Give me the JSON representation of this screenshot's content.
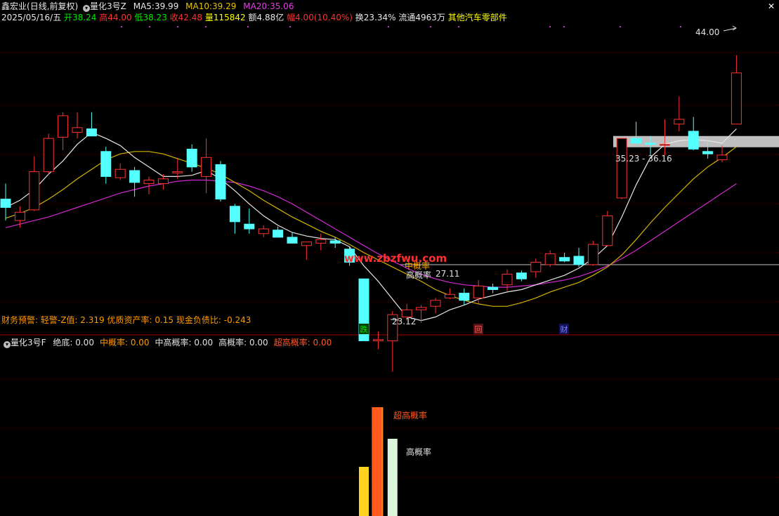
{
  "header": {
    "stock_name": "鑫宏业",
    "period": "(日线,前复权)",
    "indicator": "量化3号Z",
    "ma5_label": "MA5:",
    "ma5_value": "39.99",
    "ma10_label": "MA10:",
    "ma10_value": "39.29",
    "ma20_label": "MA20:",
    "ma20_value": "35.06"
  },
  "quote": {
    "date": "2025/05/16/五",
    "open_label": "开",
    "open": "38.24",
    "high_label": "高",
    "high": "44.00",
    "low_label": "低",
    "low": "38.23",
    "close_label": "收",
    "close": "42.48",
    "vol_label": "量",
    "volume": "115842",
    "amount_label": "额",
    "amount": "4.88亿",
    "change_label": "幅",
    "change": "4.00(10.40%)",
    "turnover_label": "换",
    "turnover": "23.34%",
    "float_label": "流通",
    "float": "4963万",
    "sector": "其他汽车零部件"
  },
  "finance_bar": {
    "prefix": "财务预警: 轻警-Z值: ",
    "z_value": "2.319",
    "quality_label": " 优质资产率: ",
    "quality_value": "0.15",
    "cash_label": " 现金负债比: ",
    "cash_value": "-0.243"
  },
  "sub_header": {
    "indicator": "量化3号F",
    "items": [
      {
        "label": "绝底:",
        "value": "0.00",
        "color": "#e0e0e0"
      },
      {
        "label": "中概率:",
        "value": "0.00",
        "color": "#ff9900"
      },
      {
        "label": "中高概率:",
        "value": "0.00",
        "color": "#e0e0e0"
      },
      {
        "label": "高概率:",
        "value": "0.00",
        "color": "#e0e0e0"
      },
      {
        "label": "超高概率:",
        "value": "0.00",
        "color": "#ff5a2a"
      }
    ]
  },
  "annotations": {
    "high_price": "44.00",
    "range": "35.23 - 36.16",
    "mid_prob": "中概率",
    "high_prob": "高概率",
    "level_27": "27.11",
    "low_price": "23.12",
    "low_prefix": "",
    "marker_die": "跌",
    "marker_hui": "回",
    "marker_cai": "财",
    "super_high_label": "超高概率",
    "high_label_sub": "高概率",
    "watermark": "www.zbzfwu.com"
  },
  "colors": {
    "up": "#ff3232",
    "down": "#54ffff",
    "ma5": "#e6e6e6",
    "ma10": "#d4b300",
    "ma20": "#d228d2",
    "label_up": "#ff3232",
    "label_down": "#00e600",
    "label_yellow": "#ffff00",
    "label_orange": "#ff9900"
  },
  "chart_data": {
    "type": "candlestick",
    "y_unit": "price",
    "ylim": [
      21.5,
      46.5
    ],
    "candles": [
      {
        "o": 31.9,
        "h": 33.2,
        "l": 30.1,
        "c": 31.2
      },
      {
        "o": 30.1,
        "h": 31.3,
        "l": 29.5,
        "c": 30.8
      },
      {
        "o": 31.0,
        "h": 35.5,
        "l": 30.9,
        "c": 34.2
      },
      {
        "o": 34.2,
        "h": 37.4,
        "l": 33.9,
        "c": 37.0
      },
      {
        "o": 37.1,
        "h": 39.2,
        "l": 36.0,
        "c": 38.9
      },
      {
        "o": 37.5,
        "h": 39.2,
        "l": 37.0,
        "c": 37.9
      },
      {
        "o": 37.8,
        "h": 39.2,
        "l": 37.2,
        "c": 37.2
      },
      {
        "o": 35.9,
        "h": 36.3,
        "l": 33.2,
        "c": 33.8
      },
      {
        "o": 33.7,
        "h": 34.9,
        "l": 33.5,
        "c": 34.4
      },
      {
        "o": 34.3,
        "h": 34.6,
        "l": 32.1,
        "c": 33.3
      },
      {
        "o": 33.2,
        "h": 33.8,
        "l": 32.3,
        "c": 33.5
      },
      {
        "o": 33.2,
        "h": 34.0,
        "l": 32.7,
        "c": 33.6
      },
      {
        "o": 34.1,
        "h": 35.3,
        "l": 33.6,
        "c": 34.2
      },
      {
        "o": 36.1,
        "h": 36.5,
        "l": 34.2,
        "c": 34.6
      },
      {
        "o": 33.8,
        "h": 37.0,
        "l": 32.4,
        "c": 35.4
      },
      {
        "o": 34.8,
        "h": 35.1,
        "l": 31.7,
        "c": 31.9
      },
      {
        "o": 31.3,
        "h": 31.5,
        "l": 29.0,
        "c": 30.0
      },
      {
        "o": 29.8,
        "h": 31.1,
        "l": 29.0,
        "c": 29.4
      },
      {
        "o": 29.0,
        "h": 29.7,
        "l": 28.7,
        "c": 29.4
      },
      {
        "o": 29.3,
        "h": 29.6,
        "l": 28.8,
        "c": 28.7
      },
      {
        "o": 28.7,
        "h": 29.1,
        "l": 28.3,
        "c": 28.2
      },
      {
        "o": 28.0,
        "h": 28.3,
        "l": 26.8,
        "c": 28.3
      },
      {
        "o": 28.2,
        "h": 29.0,
        "l": 27.6,
        "c": 28.5
      },
      {
        "o": 28.4,
        "h": 28.7,
        "l": 27.8,
        "c": 28.2
      },
      {
        "o": 27.7,
        "h": 27.9,
        "l": 26.3,
        "c": 26.6
      },
      {
        "o": 25.2,
        "h": 25.2,
        "l": 20.0,
        "c": 20.0
      },
      {
        "o": 20.0,
        "h": 20.8,
        "l": 19.3,
        "c": 20.1
      },
      {
        "o": 20.0,
        "h": 22.5,
        "l": 17.4,
        "c": 22.2
      },
      {
        "o": 22.0,
        "h": 23.1,
        "l": 21.7,
        "c": 22.6
      },
      {
        "o": 22.6,
        "h": 23.0,
        "l": 21.5,
        "c": 22.8
      },
      {
        "o": 22.9,
        "h": 23.6,
        "l": 22.3,
        "c": 23.4
      },
      {
        "o": 23.6,
        "h": 24.4,
        "l": 23.5,
        "c": 23.9
      },
      {
        "o": 24.0,
        "h": 24.4,
        "l": 23.0,
        "c": 23.4
      },
      {
        "o": 23.6,
        "h": 25.1,
        "l": 23.1,
        "c": 24.6
      },
      {
        "o": 24.5,
        "h": 24.8,
        "l": 24.0,
        "c": 24.3
      },
      {
        "o": 24.7,
        "h": 26.0,
        "l": 24.2,
        "c": 25.6
      },
      {
        "o": 25.7,
        "h": 25.9,
        "l": 25.0,
        "c": 25.2
      },
      {
        "o": 25.8,
        "h": 26.9,
        "l": 25.3,
        "c": 26.6
      },
      {
        "o": 26.4,
        "h": 27.6,
        "l": 26.2,
        "c": 27.3
      },
      {
        "o": 27.0,
        "h": 27.4,
        "l": 26.6,
        "c": 26.7
      },
      {
        "o": 27.1,
        "h": 27.8,
        "l": 26.2,
        "c": 26.4
      },
      {
        "o": 26.4,
        "h": 28.4,
        "l": 26.3,
        "c": 28.1
      },
      {
        "o": 28.0,
        "h": 30.9,
        "l": 28.0,
        "c": 30.5
      },
      {
        "o": 32.0,
        "h": 37.0,
        "l": 31.9,
        "c": 37.0
      },
      {
        "o": 37.0,
        "h": 38.4,
        "l": 36.7,
        "c": 36.6
      },
      {
        "o": 36.6,
        "h": 37.2,
        "l": 35.6,
        "c": 36.5
      },
      {
        "o": 36.5,
        "h": 38.6,
        "l": 35.6,
        "c": 36.5
      },
      {
        "o": 38.2,
        "h": 40.5,
        "l": 37.6,
        "c": 38.6
      },
      {
        "o": 37.6,
        "h": 38.8,
        "l": 36.0,
        "c": 36.1
      },
      {
        "o": 35.9,
        "h": 36.8,
        "l": 35.3,
        "c": 35.7
      },
      {
        "o": 35.2,
        "h": 36.4,
        "l": 35.0,
        "c": 35.6
      },
      {
        "o": 38.2,
        "h": 44.0,
        "l": 38.2,
        "c": 42.5
      }
    ],
    "ma5": [
      31.2,
      31.8,
      32.7,
      34.0,
      35.1,
      36.5,
      37.5,
      37.0,
      36.4,
      35.4,
      34.6,
      33.8,
      33.8,
      33.9,
      34.3,
      33.6,
      32.6,
      31.5,
      30.5,
      29.7,
      29.1,
      28.8,
      28.6,
      28.5,
      27.9,
      26.3,
      25.0,
      23.5,
      22.0,
      21.7,
      22.0,
      22.6,
      23.0,
      23.5,
      23.8,
      24.1,
      24.3,
      24.7,
      25.1,
      25.5,
      26.1,
      26.9,
      28.0,
      30.4,
      33.1,
      35.4,
      36.5,
      36.8,
      36.9,
      36.8,
      36.6,
      37.8
    ],
    "ma10": [
      30.3,
      30.7,
      31.2,
      31.9,
      32.7,
      33.6,
      34.4,
      35.2,
      35.7,
      35.9,
      35.9,
      35.7,
      35.3,
      34.9,
      34.5,
      34.0,
      33.3,
      32.6,
      31.8,
      31.1,
      30.4,
      29.8,
      29.2,
      28.7,
      28.1,
      27.4,
      26.8,
      26.2,
      25.6,
      25.0,
      24.3,
      23.8,
      23.4,
      23.1,
      22.9,
      22.9,
      23.2,
      23.6,
      24.1,
      24.5,
      24.9,
      25.5,
      26.2,
      27.2,
      28.5,
      29.9,
      31.2,
      32.4,
      33.6,
      34.6,
      35.4,
      36.3
    ],
    "ma20": [
      29.5,
      29.8,
      30.1,
      30.4,
      30.8,
      31.2,
      31.6,
      32.0,
      32.4,
      32.7,
      33.0,
      33.2,
      33.4,
      33.5,
      33.5,
      33.4,
      33.3,
      33.0,
      32.6,
      32.1,
      31.5,
      30.8,
      30.1,
      29.4,
      28.7,
      28.0,
      27.3,
      26.7,
      26.1,
      25.6,
      25.2,
      24.9,
      24.7,
      24.6,
      24.5,
      24.5,
      24.6,
      24.7,
      24.9,
      25.1,
      25.4,
      25.8,
      26.3,
      26.9,
      27.6,
      28.4,
      29.2,
      30.0,
      30.8,
      31.6,
      32.4,
      33.2
    ],
    "sub_bars": [
      {
        "index": 25,
        "value": 0.28,
        "color": "#ffd21e",
        "name": "sub-bar-yellow"
      },
      {
        "index": 26,
        "value": 0.62,
        "color": "#ff8c1e",
        "name": "sub-bar-orange"
      },
      {
        "index": 26,
        "value": 0.62,
        "color": "#ff5a1e",
        "name": "sub-bar-red"
      },
      {
        "index": 27,
        "value": 0.44,
        "color": "#dcf5dc",
        "name": "sub-bar-pale"
      }
    ]
  }
}
